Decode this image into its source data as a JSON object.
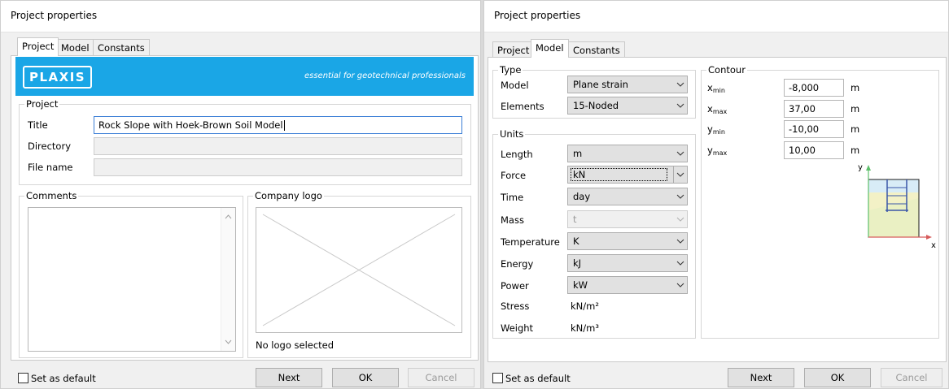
{
  "left_dialog": {
    "title": "Project properties",
    "tabs": [
      "Project",
      "Model",
      "Constants"
    ],
    "active_tab": "Project",
    "banner": {
      "logo": "PLAXIS",
      "tagline": "essential for geotechnical professionals",
      "color": "#1aa6e6"
    },
    "project_group": {
      "title": "Project",
      "title_label": "Title",
      "title_value": "Rock Slope with Hoek-Brown Soil Model",
      "directory_label": "Directory",
      "directory_value": "",
      "filename_label": "File name",
      "filename_value": ""
    },
    "comments_group": {
      "title": "Comments",
      "value": ""
    },
    "company_logo_group": {
      "title": "Company logo",
      "status": "No logo selected"
    },
    "footer": {
      "set_default": "Set as default",
      "set_default_checked": false,
      "next": "Next",
      "ok": "OK",
      "cancel": "Cancel"
    }
  },
  "right_dialog": {
    "title": "Project properties",
    "tabs": [
      "Project",
      "Model",
      "Constants"
    ],
    "active_tab": "Model",
    "type_group": {
      "title": "Type",
      "model_label": "Model",
      "model_value": "Plane strain",
      "elements_label": "Elements",
      "elements_value": "15-Noded"
    },
    "units_group": {
      "title": "Units",
      "rows": [
        {
          "label": "Length",
          "value": "m"
        },
        {
          "label": "Force",
          "value": "kN"
        },
        {
          "label": "Time",
          "value": "day"
        },
        {
          "label": "Mass",
          "value": "t"
        },
        {
          "label": "Temperature",
          "value": "K"
        },
        {
          "label": "Energy",
          "value": "kJ"
        },
        {
          "label": "Power",
          "value": "kW"
        },
        {
          "label": "Stress",
          "value": "kN/m²"
        },
        {
          "label": "Weight",
          "value": "kN/m³"
        }
      ]
    },
    "contour_group": {
      "title": "Contour",
      "rows": [
        {
          "var": "x",
          "sub": "min",
          "value": "-8,000",
          "unit": "m"
        },
        {
          "var": "x",
          "sub": "max",
          "value": "37,00",
          "unit": "m"
        },
        {
          "var": "y",
          "sub": "min",
          "value": "-10,00",
          "unit": "m"
        },
        {
          "var": "y",
          "sub": "max",
          "value": "10,00",
          "unit": "m"
        }
      ],
      "axis_y": "y",
      "axis_x": "x"
    },
    "footer": {
      "set_default": "Set as default",
      "set_default_checked": false,
      "next": "Next",
      "ok": "OK",
      "cancel": "Cancel"
    }
  }
}
